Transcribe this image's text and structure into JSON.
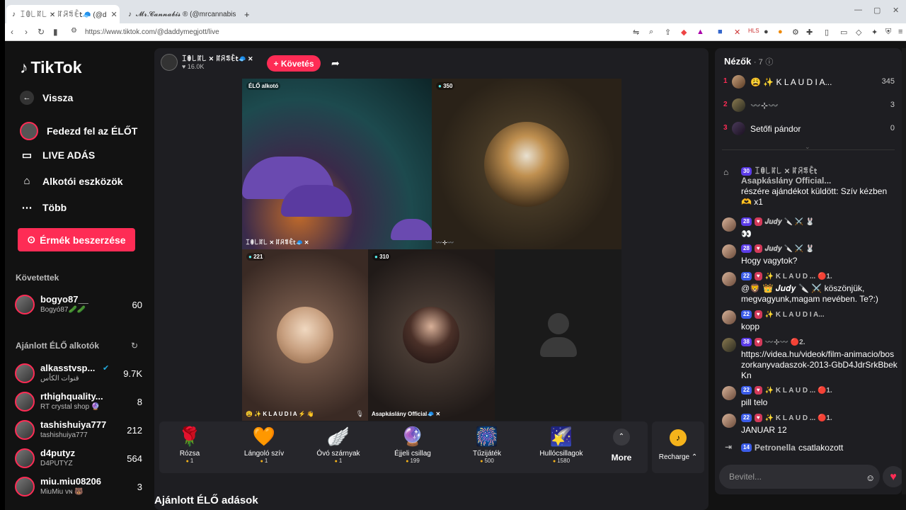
{
  "browser": {
    "tabs": [
      {
        "title": "ꀤꂦ꒒ꍏ꒒ ✕ ꍏꋪꁄꍟ𝗍🧢 (@d",
        "active": true
      },
      {
        "title": "𝓜𝓻.𝓒𝓪𝓷𝓷𝓪𝓫𝓲𝓼 ® (@mrcannabis_)",
        "active": false
      }
    ],
    "new_tab": "+",
    "url": "https://www.tiktok.com/@daddymegjott/live"
  },
  "sidebar": {
    "logo": "TikTok",
    "back": "Vissza",
    "nav": [
      {
        "label": "Fedezd fel az ÉLŐT",
        "icon": "explore-live-icon"
      },
      {
        "label": "LIVE ADÁS",
        "icon": "camera-icon"
      },
      {
        "label": "Alkotói eszközök",
        "icon": "creator-tools-icon"
      },
      {
        "label": "Több",
        "icon": "more-dots-icon"
      }
    ],
    "coins_button": "Érmék beszerzése",
    "following_title": "Követettek",
    "following": [
      {
        "name": "bogyo87__",
        "sub": "Bogyó87🥒🥒",
        "count": "60"
      }
    ],
    "suggested_title": "Ajánlott ÉLŐ alkotók",
    "suggested": [
      {
        "name": "alkasstvsp...",
        "sub": "قنوات الكأس",
        "count": "9.7K",
        "verified": true
      },
      {
        "name": "rthighquality...",
        "sub": "RT crystal shop 🔮",
        "count": "8"
      },
      {
        "name": "tashishuiya777",
        "sub": "tashishuiya777",
        "count": "212"
      },
      {
        "name": "d4putyz",
        "sub": "D4PUTYZ",
        "count": "564"
      },
      {
        "name": "miu.miu08206",
        "sub": "MiuMiu ᴠɴ 🐻",
        "count": "3"
      }
    ]
  },
  "main": {
    "host_name": "ꀤꂦ꒒ꍏ꒒ ✕ ꍏꋪꁄꍟ𝗍🧢 ✕",
    "host_likes": "16.0K",
    "follow_button": "+ Követés",
    "cells": [
      {
        "badge": "ÉLŐ alkotó",
        "caption": "ꀤꂦ꒒ꍏ꒒ ✕ ꍏꋪꁄꍟ𝗍🧢 ✕"
      },
      {
        "badge": "350",
        "caption": "〰️⊹〰️"
      },
      {
        "badge": "221",
        "caption": "😩 ✨ K L A U D I A ⚡ 👋"
      },
      {
        "badge": "310",
        "caption": "Asapkáslány Official🧢 ✕"
      }
    ],
    "gifts": [
      {
        "name": "Rózsa",
        "price": "1",
        "icon": "🌹"
      },
      {
        "name": "Lángoló szív",
        "price": "1",
        "icon": "🧡"
      },
      {
        "name": "Óvó szárnyak",
        "price": "1",
        "icon": "🪽"
      },
      {
        "name": "Éjjeli csillag",
        "price": "199",
        "icon": "🔮"
      },
      {
        "name": "Tűzijáték",
        "price": "500",
        "icon": "🎆"
      },
      {
        "name": "Hullócsillagok",
        "price": "1580",
        "icon": "🌠"
      }
    ],
    "more": "More",
    "recharge": "Recharge ⌃",
    "bottom_title": "Ajánlott ÉLŐ adások"
  },
  "chat": {
    "viewers_title": "Nézők",
    "viewers_count": "· 7",
    "viewers": [
      {
        "rank": "1",
        "name": "😩 ✨ K L A U D I A...",
        "score": "345"
      },
      {
        "rank": "2",
        "name": "〰️⊹〰️",
        "score": "3"
      },
      {
        "rank": "3",
        "name": "Setőfi pándor",
        "score": "0"
      }
    ],
    "messages": [
      {
        "level": "30",
        "name": "ꀤꂦ꒒ꍏ꒒ ✕ ꍏꋪꁄꍟ𝗍",
        "sub": "Asapkáslány Official...",
        "text": "részére ajándékot küldött: Szív kézben\n🫶 x1"
      },
      {
        "level": "28",
        "name": "𝑱𝒖𝒅𝒚 🔪 ⚔️ 🐰",
        "text": "👀"
      },
      {
        "level": "28",
        "name": "𝑱𝒖𝒅𝒚 🔪 ⚔️ 🐰",
        "text": "Hogy vagytok?"
      },
      {
        "level": "22",
        "name": "✨ K L A U D ... 🔴1.",
        "text": "@🦁 👑 𝑱𝒖𝒅𝒚 🔪 ⚔️ köszönjük, megvagyunk,magam nevében. Te?:)"
      },
      {
        "level": "22",
        "name": "✨ K L A U D I A...",
        "text": "kopp"
      },
      {
        "level": "38",
        "name": "〰️⊹〰️ 🔴2.",
        "text": "https://videa.hu/videok/film-animacio/boszorkanyvadaszok-2013-GbD4JdrSrkBbekKn"
      },
      {
        "level": "22",
        "name": "✨ K L A U D ... 🔴1.",
        "text": "pill telo"
      },
      {
        "level": "22",
        "name": "✨ K L A U D ... 🔴1.",
        "text": "JANUAR 12"
      }
    ],
    "join": {
      "level": "14",
      "name": "Petronella",
      "action": "csatlakozott"
    },
    "input_placeholder": "Bevitel..."
  }
}
